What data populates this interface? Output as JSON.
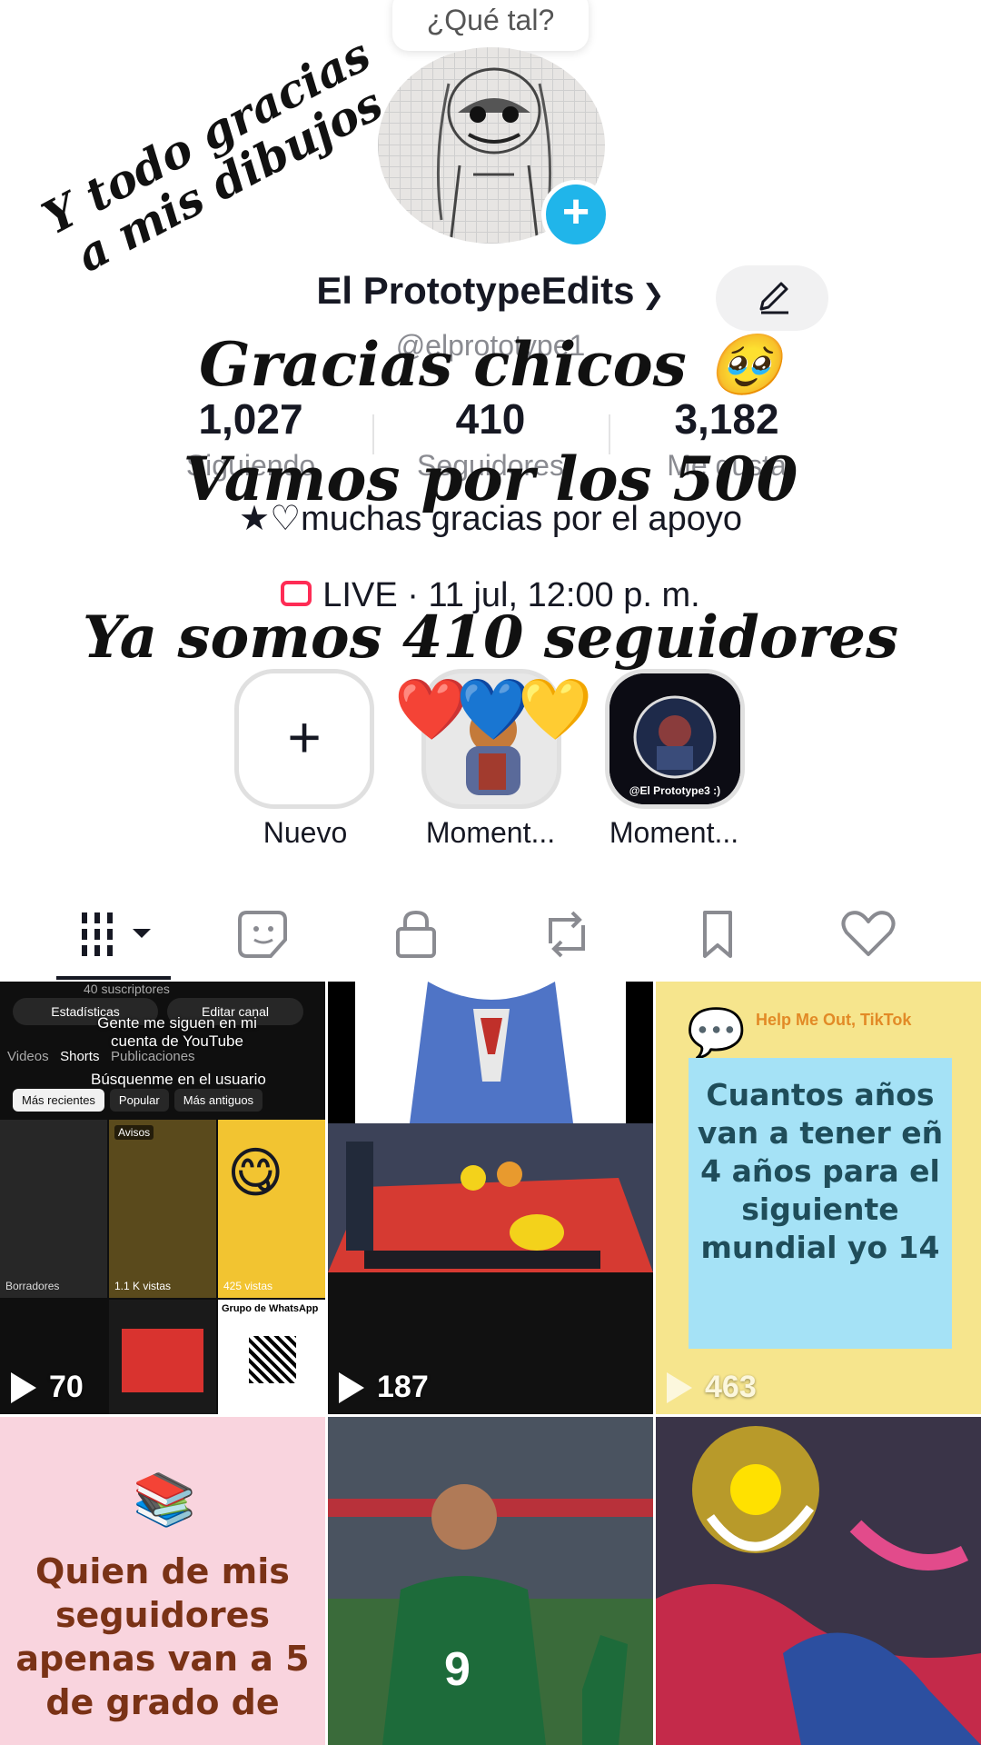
{
  "profile": {
    "bubble_text": "¿Qué tal?",
    "display_name": "El PrototypeEdits",
    "handle": "@elprototype1",
    "bio": "★♡muchas gracias por el apoyo",
    "live": "LIVE · 11 jul, 12:00 p. m.",
    "stats": [
      {
        "value": "1,027",
        "label": "Siguiendo"
      },
      {
        "value": "410",
        "label": "Seguidores"
      },
      {
        "value": "3,182",
        "label": "Me gusta"
      }
    ]
  },
  "overlays": {
    "drawings": "Y todo gracias a mis dibujos",
    "thanks": "Gracias chicos 🥹",
    "goal": "Vamos por los 500",
    "count": "Ya somos 410 seguidores"
  },
  "stories": [
    {
      "label": "Nuevo",
      "icon": "plus-icon"
    },
    {
      "label": "Moment...",
      "overlay": "❤️💙💛"
    },
    {
      "label": "Moment...",
      "caption": "@El Prototype3 :)"
    }
  ],
  "tabs": [
    "grid-icon",
    "sticker-icon",
    "lock-icon",
    "repost-icon",
    "bookmark-icon",
    "heart-icon"
  ],
  "videos": [
    {
      "views": "70",
      "screenshot": {
        "subs": "40 suscriptores",
        "stats_btn": "Estadísticas",
        "edit_btn": "Editar canal",
        "caption1": "Gente me siguen en mi cuenta de YouTube",
        "caption2": "Búsquenme en el usuario",
        "tabs": [
          "Videos",
          "Shorts",
          "Publicaciones"
        ],
        "filters": [
          "Más recientes",
          "Popular",
          "Más antiguos"
        ],
        "drafts": "Borradores",
        "avisos": "Avisos",
        "tile_views": [
          "1.1 K vistas",
          "425 vistas"
        ],
        "group": "Grupo de WhatsApp"
      }
    },
    {
      "views": "187"
    },
    {
      "views": "463",
      "header": "Help Me Out, TikTok",
      "question": "Cuantos años van a tener eñ 4 años para el siguiente mundial yo 14"
    },
    {
      "question": "Quien de mis seguidores apenas van a 5 de grado de"
    },
    {
      "jersey": "9"
    },
    {}
  ],
  "colors": {
    "accent": "#fe2c55",
    "blue": "#20b5ea",
    "text": "#161823",
    "muted": "#8a8b91"
  }
}
